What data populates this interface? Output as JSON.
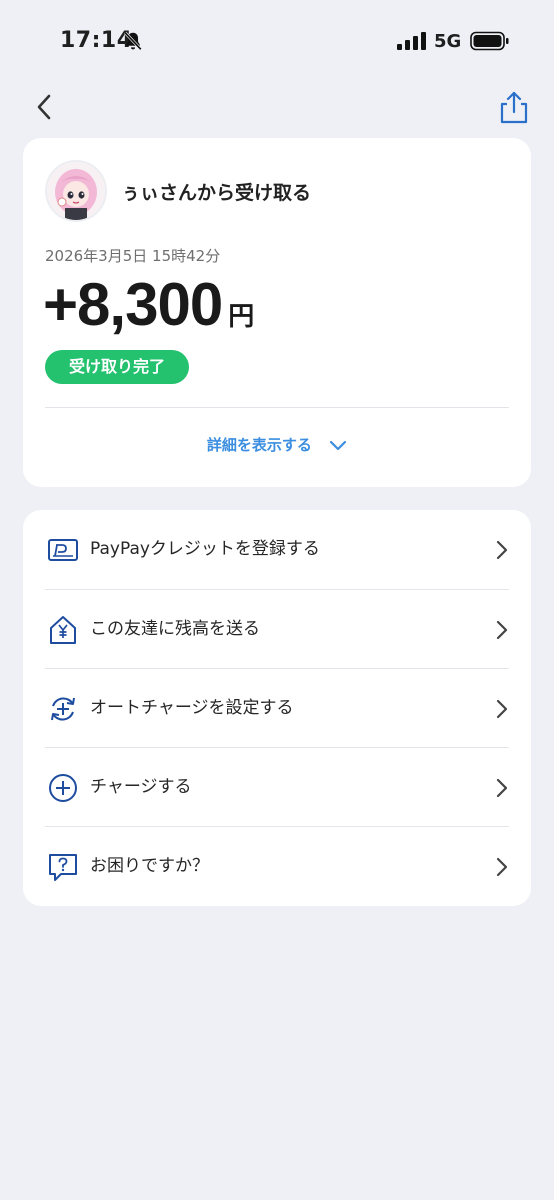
{
  "status_bar": {
    "time": "17:14",
    "network": "5G",
    "icons": [
      "bell-slash-icon",
      "signal-bars-icon",
      "battery-icon"
    ]
  },
  "nav": {
    "icons": [
      "chevron-left-icon",
      "share-upload-icon"
    ]
  },
  "transaction": {
    "title": "ぅぃさんから受け取る",
    "date": "2026年3月5日 15時42分",
    "amount": "+8,300",
    "currency": "円",
    "status": "受け取り完了",
    "details_label": "詳細を表示する"
  },
  "menu": {
    "items": [
      {
        "label": "PayPayクレジットを登録する",
        "icon": "paypay-credit-card-icon"
      },
      {
        "label": "この友達に残高を送る",
        "icon": "send-yen-house-icon"
      },
      {
        "label": "オートチャージを設定する",
        "icon": "auto-charge-icon"
      },
      {
        "label": "チャージする",
        "icon": "plus-circle-icon"
      },
      {
        "label": "お困りですか？",
        "icon": "help-question-icon"
      }
    ]
  },
  "colors": {
    "accent_blue": "#3b8ee0",
    "icon_navy": "#1e4da0",
    "success_green": "#24c16e",
    "background": "#eef0f5"
  }
}
